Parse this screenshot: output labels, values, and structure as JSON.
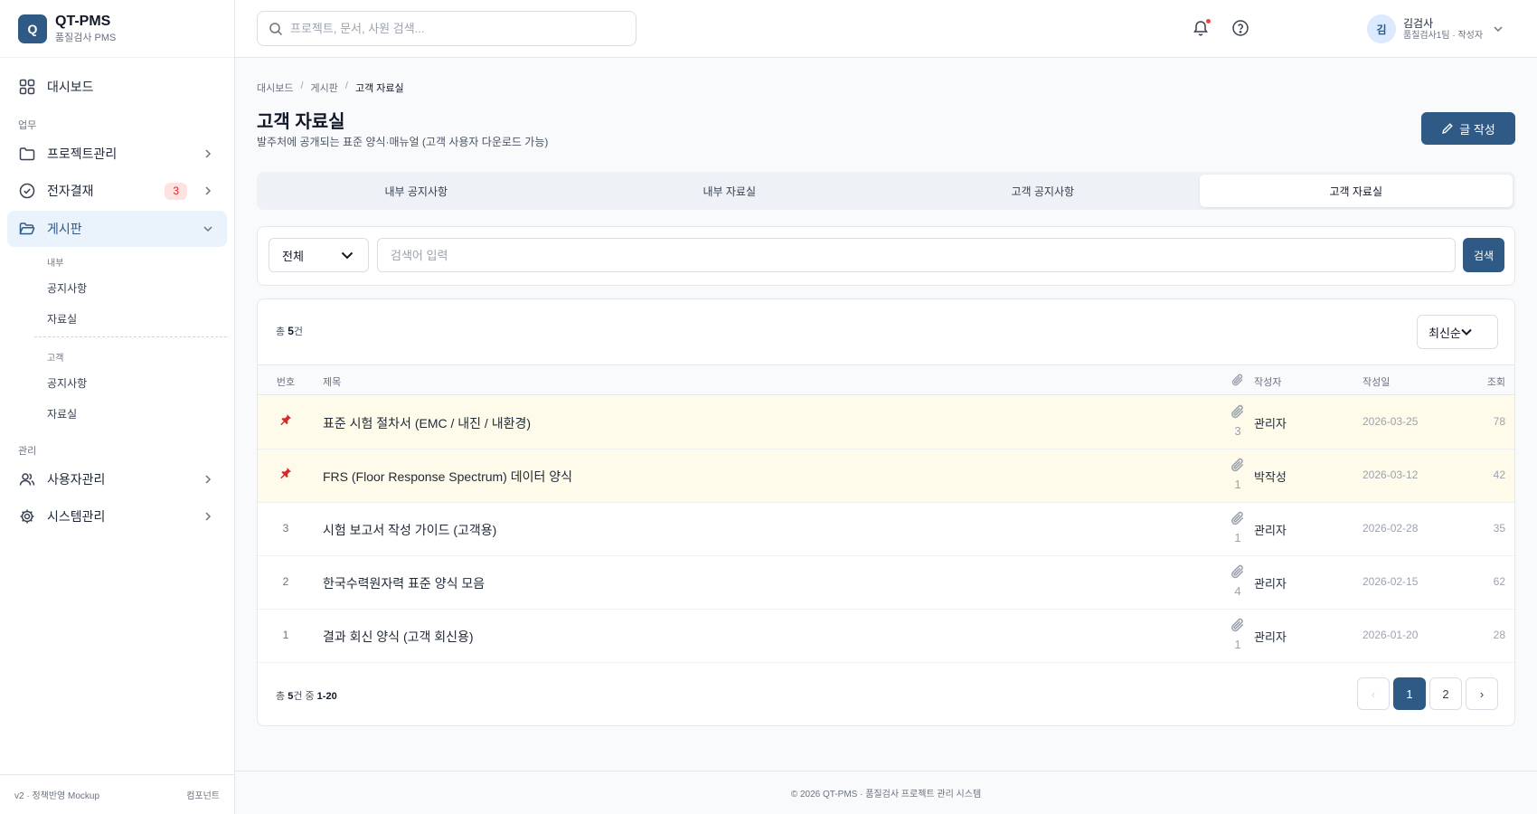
{
  "app": {
    "logo_letter": "Q",
    "title": "QT-PMS",
    "subtitle": "품질검사 PMS"
  },
  "sidebar": {
    "dashboard": "대시보드",
    "section_work": "업무",
    "project": "프로젝트관리",
    "approval": "전자결재",
    "approval_badge": "3",
    "board": "게시판",
    "internal_label": "내부",
    "internal_notice": "공지사항",
    "internal_files": "자료실",
    "customer_label": "고객",
    "customer_notice": "공지사항",
    "customer_files": "자료실",
    "section_admin": "관리",
    "users": "사용자관리",
    "system": "시스템관리",
    "footer_version": "v2 · 정책반영 Mockup",
    "footer_right": "컴포넌트"
  },
  "topbar": {
    "search_placeholder": "프로젝트, 문서, 사원 검색...",
    "user_initial": "김",
    "user_name": "김검사",
    "user_role": "품질검사1팀 · 작성자"
  },
  "breadcrumb": [
    "대시보드",
    "게시판",
    "고객 자료실"
  ],
  "page": {
    "title": "고객 자료실",
    "description": "발주처에 공개되는 표준 양식·매뉴얼 (고객 사용자 다운로드 가능)",
    "write_button": "글 작성"
  },
  "tabs": [
    "내부 공지사항",
    "내부 자료실",
    "고객 공지사항",
    "고객 자료실"
  ],
  "filter": {
    "scope_value": "전체",
    "keyword_placeholder": "검색어 입력",
    "search_button": "검색"
  },
  "list": {
    "total_prefix": "총 ",
    "total_count": "5",
    "total_suffix": "건",
    "sort_value": "최신순",
    "columns": {
      "no": "번호",
      "title": "제목",
      "author": "작성자",
      "date": "작성일",
      "views": "조회"
    },
    "rows": [
      {
        "pinned": true,
        "no": "",
        "title": "표준 시험 절차서 (EMC / 내진 / 내환경)",
        "attachments": "3",
        "author": "관리자",
        "date": "2026-03-25",
        "views": "78"
      },
      {
        "pinned": true,
        "no": "",
        "title": "FRS (Floor Response Spectrum) 데이터 양식",
        "attachments": "1",
        "author": "박작성",
        "date": "2026-03-12",
        "views": "42"
      },
      {
        "pinned": false,
        "no": "3",
        "title": "시험 보고서 작성 가이드 (고객용)",
        "attachments": "1",
        "author": "관리자",
        "date": "2026-02-28",
        "views": "35"
      },
      {
        "pinned": false,
        "no": "2",
        "title": "한국수력원자력 표준 양식 모음",
        "attachments": "4",
        "author": "관리자",
        "date": "2026-02-15",
        "views": "62"
      },
      {
        "pinned": false,
        "no": "1",
        "title": "결과 회신 양식 (고객 회신용)",
        "attachments": "1",
        "author": "관리자",
        "date": "2026-01-20",
        "views": "28"
      }
    ]
  },
  "pagination": {
    "info_prefix": "총 ",
    "info_count": "5",
    "info_mid": "건 중 ",
    "info_range": "1-20",
    "prev": "‹",
    "pages": [
      "1",
      "2"
    ],
    "next": "›"
  },
  "footer": "© 2026 QT-PMS · 품질검사 프로젝트 관리 시스템",
  "colors": {
    "primary": "#2f5a86",
    "pinned_row": "#fffbea",
    "pin": "#dc2626",
    "badge_bg": "#fde2e2"
  }
}
